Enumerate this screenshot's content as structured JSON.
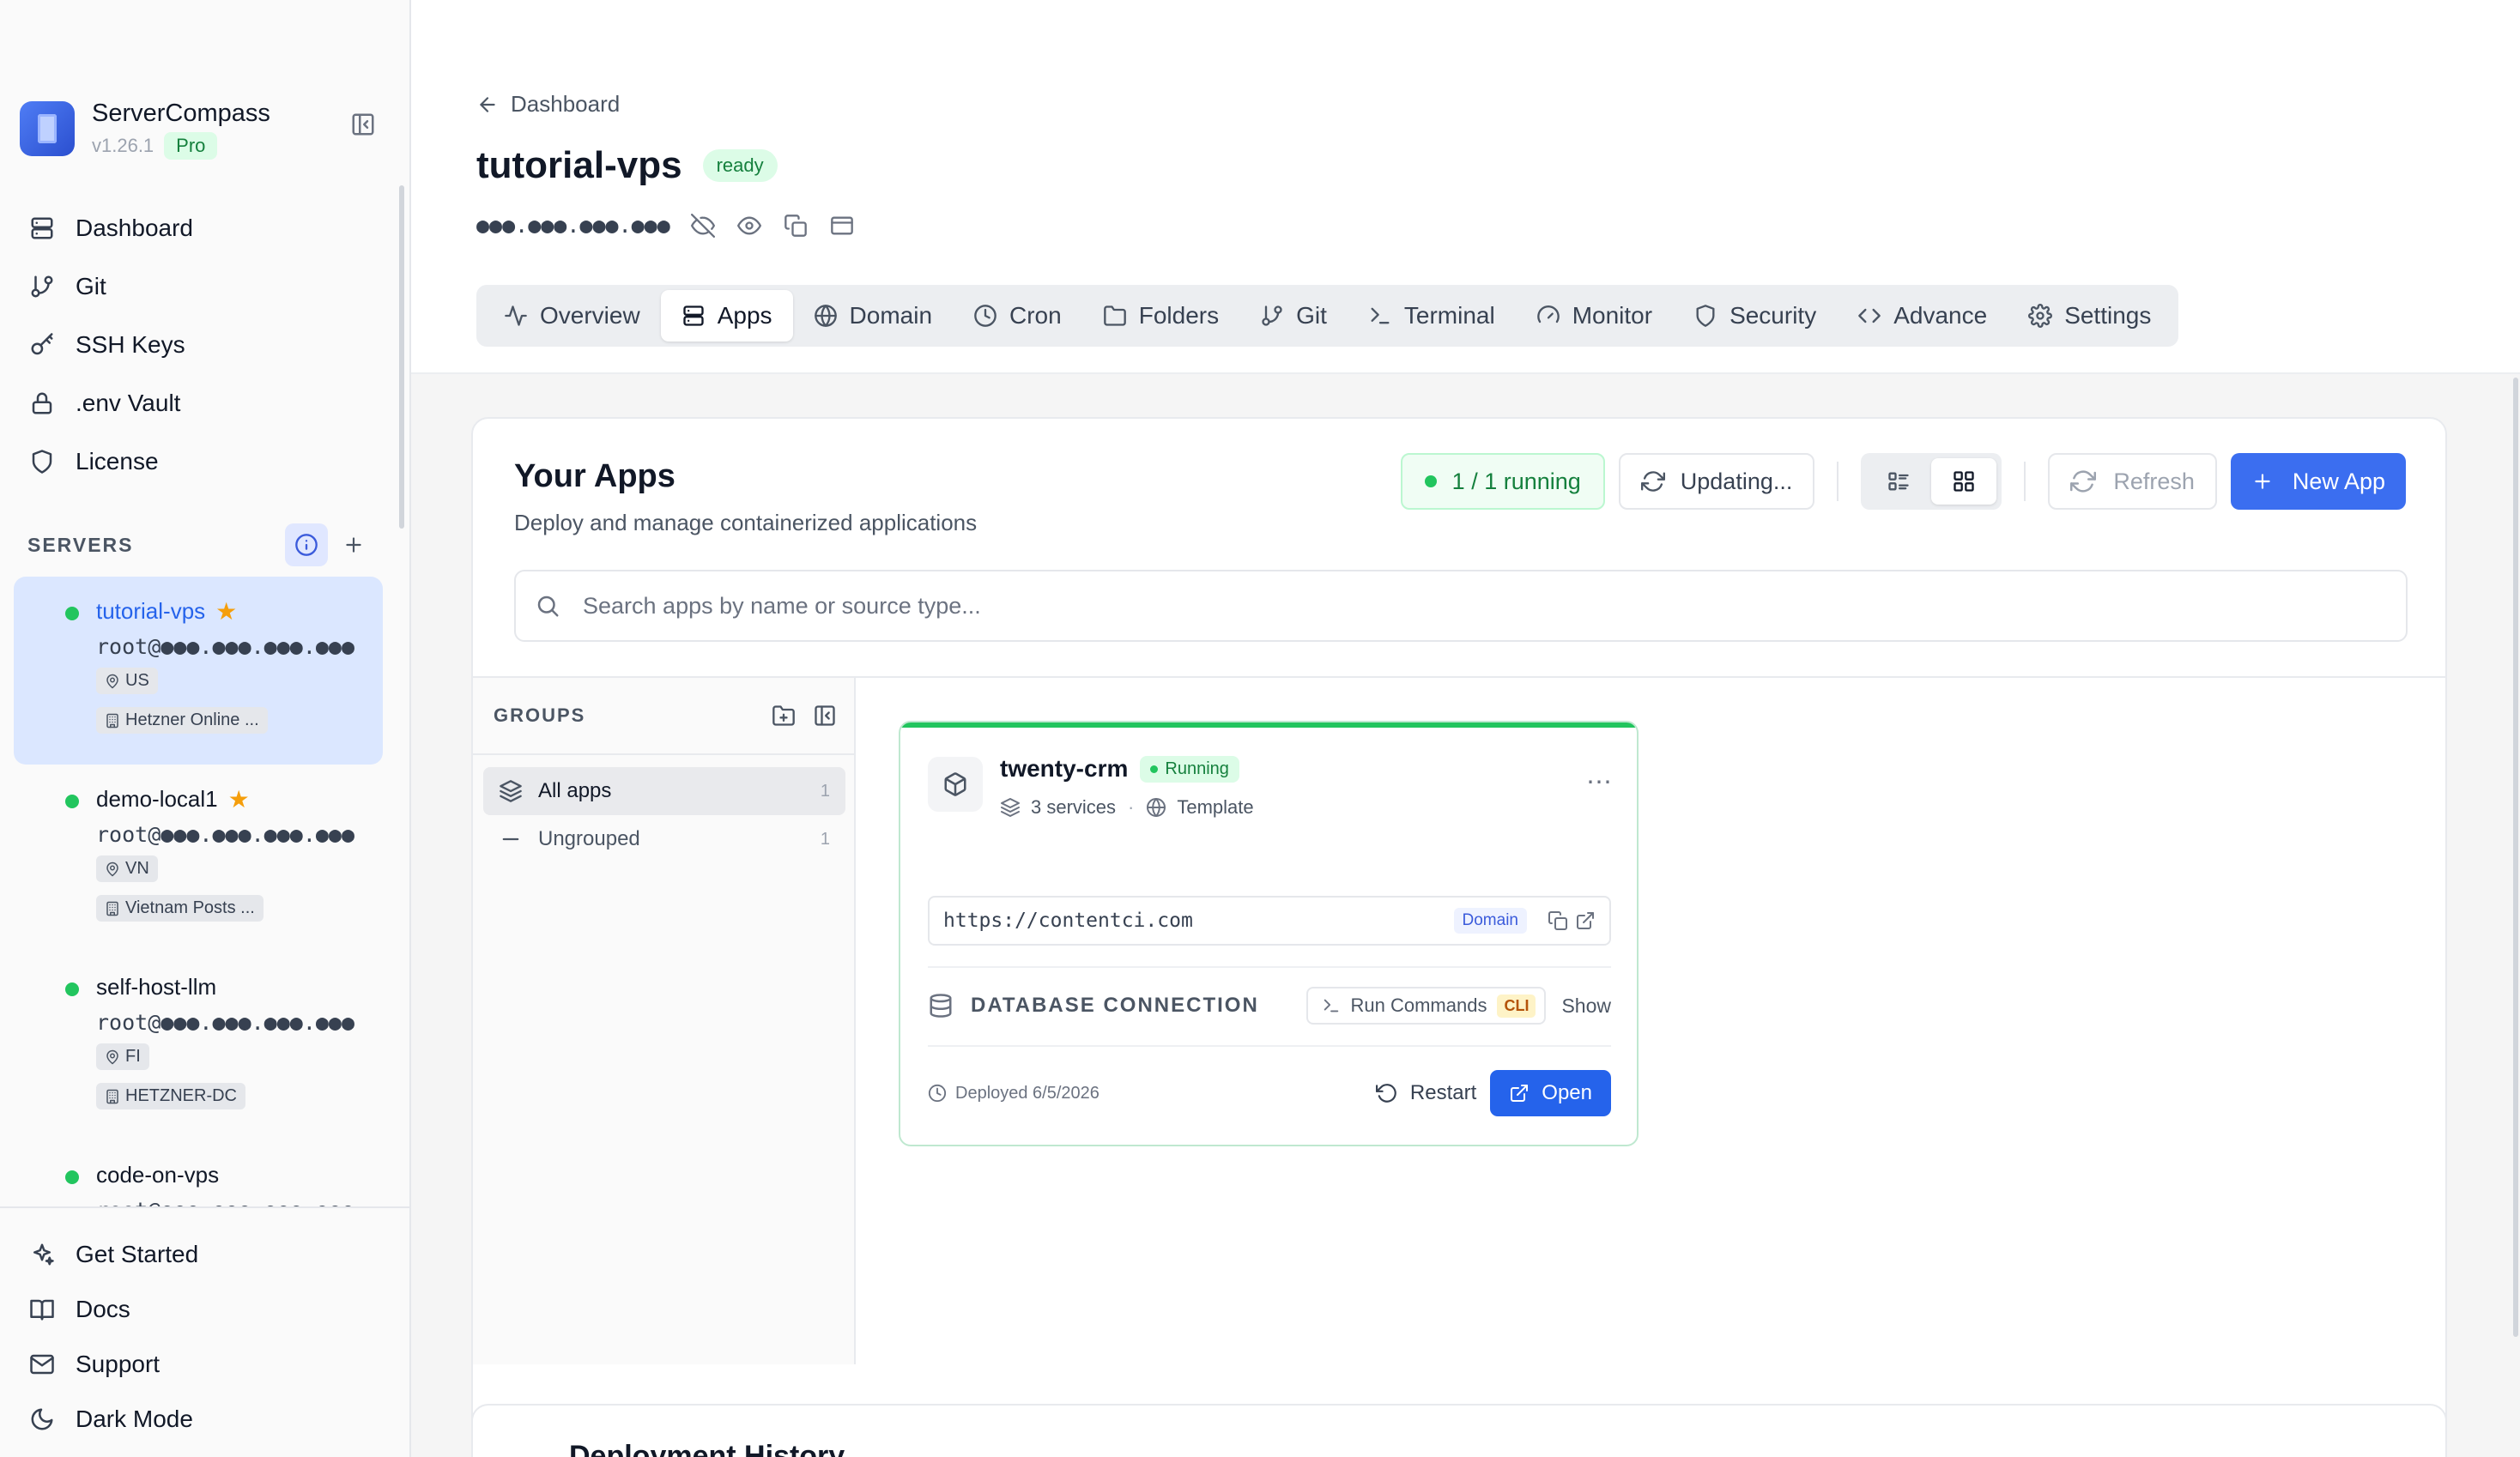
{
  "app": {
    "name": "ServerCompass",
    "version": "v1.26.1",
    "plan": "Pro"
  },
  "nav": [
    {
      "label": "Dashboard",
      "icon": "server-stack-icon"
    },
    {
      "label": "Git",
      "icon": "git-branch-icon"
    },
    {
      "label": "SSH Keys",
      "icon": "key-icon"
    },
    {
      "label": ".env Vault",
      "icon": "lock-icon"
    },
    {
      "label": "License",
      "icon": "shield-icon"
    }
  ],
  "servers": {
    "heading": "SERVERS",
    "items": [
      {
        "name": "tutorial-vps",
        "ip": "root@●●●.●●●.●●●.●●●",
        "region": "US",
        "provider": "Hetzner Online ...",
        "starred": true,
        "active": true
      },
      {
        "name": "demo-local1",
        "ip": "root@●●●.●●●.●●●.●●●",
        "region": "VN",
        "provider": "Vietnam Posts ...",
        "starred": true,
        "active": false
      },
      {
        "name": "self-host-llm",
        "ip": "root@●●●.●●●.●●●.●●●",
        "region": "FI",
        "provider": "HETZNER-DC",
        "starred": false,
        "active": false
      },
      {
        "name": "code-on-vps",
        "ip": "root@●●●.●●●.●●●.●●●",
        "region": "",
        "provider": "",
        "starred": false,
        "active": false
      }
    ]
  },
  "bottom_nav": [
    {
      "label": "Get Started",
      "icon": "sparkle-icon"
    },
    {
      "label": "Docs",
      "icon": "book-icon"
    },
    {
      "label": "Support",
      "icon": "mail-icon"
    },
    {
      "label": "Dark Mode",
      "icon": "moon-icon"
    }
  ],
  "header": {
    "back_label": "Dashboard",
    "server_name": "tutorial-vps",
    "status": "ready",
    "ip_masked": "●●●.●●●.●●●.●●●"
  },
  "tabs": [
    {
      "label": "Overview",
      "icon": "activity-icon",
      "active": false
    },
    {
      "label": "Apps",
      "icon": "server-stack-icon",
      "active": true
    },
    {
      "label": "Domain",
      "icon": "globe-icon",
      "active": false
    },
    {
      "label": "Cron",
      "icon": "clock-icon",
      "active": false
    },
    {
      "label": "Folders",
      "icon": "folder-icon",
      "active": false
    },
    {
      "label": "Git",
      "icon": "git-branch-icon",
      "active": false
    },
    {
      "label": "Terminal",
      "icon": "terminal-icon",
      "active": false
    },
    {
      "label": "Monitor",
      "icon": "gauge-icon",
      "active": false
    },
    {
      "label": "Security",
      "icon": "shield-icon",
      "active": false
    },
    {
      "label": "Advance",
      "icon": "code-icon",
      "active": false
    },
    {
      "label": "Settings",
      "icon": "gear-icon",
      "active": false
    }
  ],
  "apps": {
    "title": "Your Apps",
    "subtitle": "Deploy and manage containerized applications",
    "running": "1 / 1 running",
    "updating": "Updating...",
    "refresh": "Refresh",
    "new_app": "New App",
    "search_placeholder": "Search apps by name or source type...",
    "groups_heading": "GROUPS",
    "groups": [
      {
        "label": "All apps",
        "count": "1"
      },
      {
        "label": "Ungrouped",
        "count": "1"
      }
    ],
    "card": {
      "name": "twenty-crm",
      "status": "Running",
      "services": "3 services",
      "source": "Template",
      "url": "https://contentci.com",
      "url_badge": "Domain",
      "db_label": "DATABASE CONNECTION",
      "run_commands": "Run Commands",
      "cli_badge": "CLI",
      "show": "Show",
      "deployed": "Deployed 6/5/2026",
      "restart": "Restart",
      "open": "Open"
    }
  },
  "history": {
    "title": "Deployment History"
  },
  "colors": {
    "accent": "#3b6ef0",
    "success": "#22c55e",
    "active_bg": "#dbe7ff"
  }
}
